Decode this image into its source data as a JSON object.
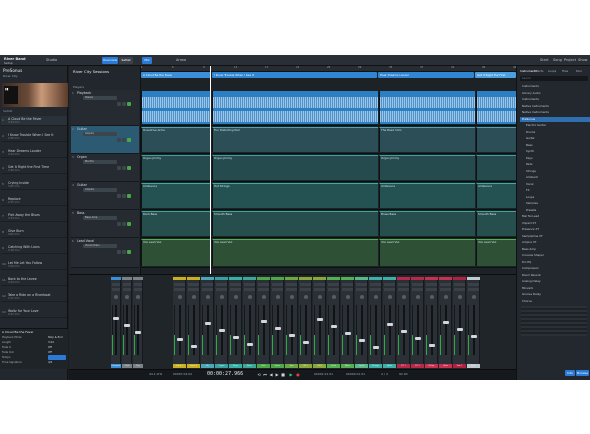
{
  "topbar": {
    "song_title": "River Band",
    "song_sub": "Setup",
    "left_status": "Studio",
    "mode_btn_1": "Overview",
    "mode_btn_2": "Setlist",
    "mode_btn_3": "Mix",
    "center_label": "Arrow",
    "right_items": [
      "Start",
      "Song",
      "Project",
      "Show"
    ]
  },
  "left_panel": {
    "title": "PreSonus",
    "subtitle": "River City",
    "section_label": "Setlist",
    "songs": [
      {
        "num": "1",
        "title": "A Cloud Be the Fever",
        "sub": "3:24 min"
      },
      {
        "num": "2",
        "title": "I Know Trouble When I See It",
        "sub": "2:58 min"
      },
      {
        "num": "3",
        "title": "Hear Dreams Louder",
        "sub": "4:12 min"
      },
      {
        "num": "4",
        "title": "Get It Right the First Time",
        "sub": "3:40 min"
      },
      {
        "num": "5",
        "title": "Crying Inside",
        "sub": "3:02 min"
      },
      {
        "num": "6",
        "title": "Replace",
        "sub": "2:51 min"
      },
      {
        "num": "7",
        "title": "Pick Away the Blues",
        "sub": "3:33 min"
      },
      {
        "num": "8",
        "title": "Give Burn",
        "sub": "4:05 min"
      },
      {
        "num": "9",
        "title": "Catching With Lions",
        "sub": "3:18 min"
      },
      {
        "num": "10",
        "title": "Let Me Let You Follow",
        "sub": "3:50 min"
      },
      {
        "num": "11",
        "title": "Back to the Levee",
        "sub": "4:20 min"
      },
      {
        "num": "12",
        "title": "Take a Ride on a Riverboat",
        "sub": "3:11 min"
      },
      {
        "num": "13",
        "title": "Waltz for Your Love",
        "sub": "2:47 min"
      }
    ]
  },
  "inspector": {
    "title": "A Cloud Be the Fever",
    "rows": [
      "Playback Mode",
      "Length",
      "Fade In",
      "Fade Out",
      "Tempo",
      "Time Signature"
    ],
    "values": [
      "Stop & End",
      "3:24",
      "Off",
      "Off",
      "92",
      "4/4"
    ]
  },
  "arrangement": {
    "title": "River City Sessions",
    "subtitle": "Players",
    "ruler": [
      "1",
      "5",
      "9",
      "13",
      "17",
      "21",
      "25",
      "29",
      "33",
      "37",
      "41",
      "45",
      "49"
    ],
    "markers": [
      {
        "label": "A Cloud Be the Fever",
        "color": "#3a8fd8"
      },
      {
        "label": "I Know Trouble When I See It",
        "color": "#2f86d2"
      },
      {
        "label": "Hear Dreams Louder",
        "color": "#2f86d2"
      },
      {
        "label": "Get It Right the First",
        "color": "#4aa0e0"
      }
    ],
    "tracks": [
      {
        "num": "1",
        "name": "Playback",
        "inst": "Stereo",
        "color": "#3a8fd8"
      },
      {
        "num": "2",
        "name": "Guitar",
        "inst": "Ampire",
        "color": "#49a7b8"
      },
      {
        "num": "3",
        "name": "Organ",
        "inst": "Mai Tai",
        "color": "#37a0a0"
      },
      {
        "num": "4",
        "name": "Guitar",
        "inst": "Ampire",
        "color": "#33b3a8"
      },
      {
        "num": "5",
        "name": "Bass",
        "inst": "Bass Amp",
        "color": "#3aa898"
      },
      {
        "num": "6",
        "name": "Lead Vocal",
        "inst": "Vocal Chain",
        "color": "#52b050"
      }
    ],
    "clip_labels": {
      "row2": [
        "Overdrive Arms",
        "Fun Distorting Pad",
        "The Road Intro"
      ],
      "row3": [
        "Organ Jimmy",
        "Organ Jimmy",
        "Organ Jimmy"
      ],
      "row4": [
        "Ambience",
        "Hot Strings",
        "Ambience",
        "Ambience"
      ],
      "row5": [
        "Rock Bass",
        "Smooth Bass",
        "Blues Bass",
        "Smooth Bass"
      ],
      "row6": [
        "Vox Lead Vox",
        "Vox Lead Vox",
        "Vox Lead Vox",
        "Vox Lead Vox"
      ]
    }
  },
  "mixer": {
    "channels": [
      {
        "label": "Playback",
        "color": "#3a8fd8"
      },
      {
        "label": "Click",
        "color": "#7a8288"
      },
      {
        "label": "Cue",
        "color": "#7a8288"
      },
      {
        "label": "Input L",
        "color": "#c8b020"
      },
      {
        "label": "Input 2",
        "color": "#c8b020"
      },
      {
        "label": "Gtr",
        "color": "#49a7b8"
      },
      {
        "label": "Organ",
        "color": "#37a0a0"
      },
      {
        "label": "Keys",
        "color": "#33b3a8"
      },
      {
        "label": "Bass",
        "color": "#3aa898"
      },
      {
        "label": "Kick",
        "color": "#4ca848"
      },
      {
        "label": "Snare",
        "color": "#4ca848"
      },
      {
        "label": "Tom",
        "color": "#6aa840"
      },
      {
        "label": "OH L",
        "color": "#8aa838"
      },
      {
        "label": "OH R",
        "color": "#8aa838"
      },
      {
        "label": "Lead",
        "color": "#52b050"
      },
      {
        "label": "BVox",
        "color": "#52b050"
      },
      {
        "label": "Synth",
        "color": "#58b888"
      },
      {
        "label": "Strings",
        "color": "#3ab0a8"
      },
      {
        "label": "Amb",
        "color": "#3ab0a8"
      },
      {
        "label": "FX 1",
        "color": "#b82848"
      },
      {
        "label": "FX 2",
        "color": "#b82848"
      },
      {
        "label": "Delay",
        "color": "#c83050"
      },
      {
        "label": "Verb",
        "color": "#c83050"
      },
      {
        "label": "Sub 1",
        "color": "#b02040"
      },
      {
        "label": "Main",
        "color": "#c0c8d0"
      }
    ]
  },
  "transport": {
    "sample_rate": "44.1 kHz",
    "time": "00:00:27.966",
    "bars": "00007.04.02",
    "tempo": "92.00",
    "sig": "4 / 4",
    "l_pos": "00001.01.01",
    "r_pos": "00049.01.01"
  },
  "browser": {
    "tabs": [
      "Instruments",
      "Effects",
      "Loops",
      "Files",
      "Pool"
    ],
    "search_placeholder": "Search",
    "items": [
      "Instruments",
      "Library Audio",
      "Instruments",
      "Native Instruments",
      "Native Instruments",
      "PreSonus",
      "Electric Guitar",
      "Drums",
      "Guitar",
      "Bass",
      "Synth",
      "Keys",
      "Pads",
      "Strings",
      "Ambient",
      "Vocal",
      "FX",
      "Loops",
      "Samples",
      "Presets",
      "Mai Tai Lead",
      "Impact XT",
      "Presence XT",
      "SampleOne XT",
      "Ampire XT",
      "Bass Amp",
      "Console Shaper",
      "Pro EQ",
      "Compressor",
      "Room Reverb",
      "Analog Delay",
      "Mixverb",
      "Groove Delay",
      "Chorus"
    ],
    "selected_index": 5,
    "bottom_btn_1": "Info",
    "bottom_btn_2": "Browse"
  }
}
